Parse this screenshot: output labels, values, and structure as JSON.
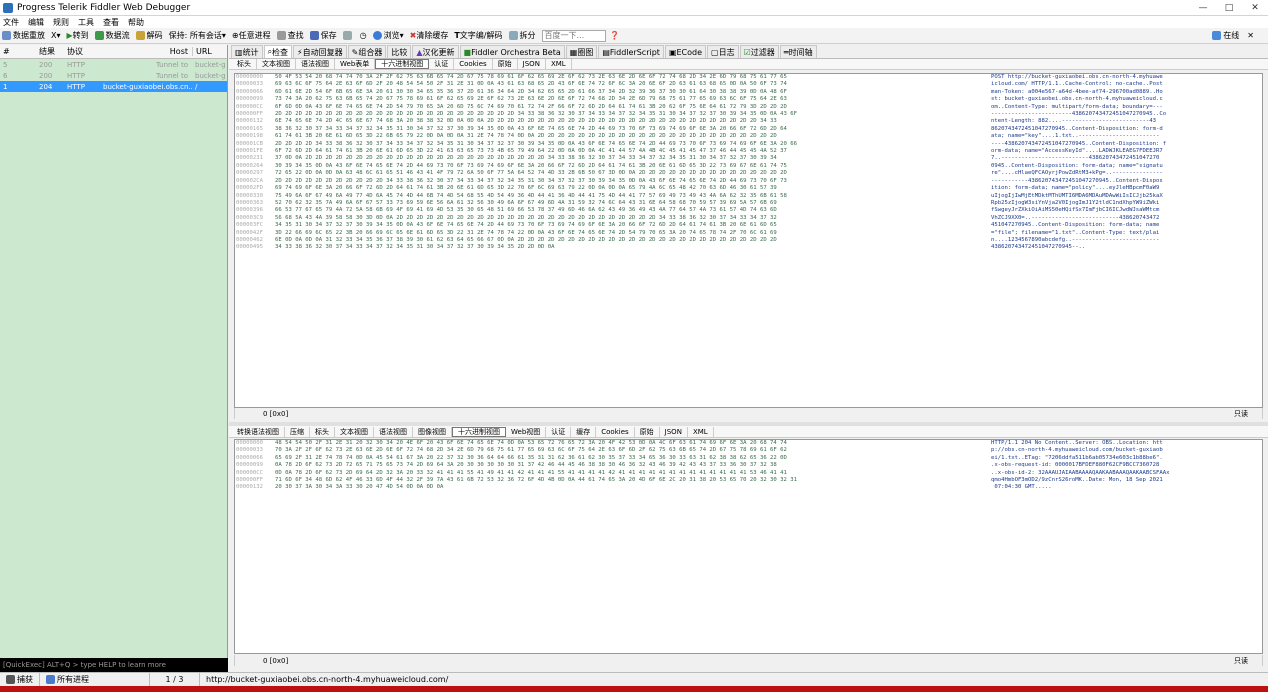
{
  "window": {
    "title": "Progress Telerik Fiddler Web Debugger"
  },
  "menu": [
    "文件",
    "编辑",
    "规则",
    "工具",
    "查看",
    "帮助"
  ],
  "toolbar": {
    "items": [
      "数据重放",
      "X",
      "转到",
      "数据流",
      "解码",
      "保持: 所有会话",
      "任意进程",
      "查找",
      "保存",
      "浏览",
      "清除缓存",
      "文字编/解码",
      "拆分"
    ],
    "search_placeholder": "百度一下...",
    "online": "在线"
  },
  "sessions": {
    "headers": [
      "#",
      "结果",
      "协议",
      "Host",
      "URL"
    ],
    "rows": [
      {
        "num": "5",
        "result": "200",
        "protocol": "HTTP",
        "host": "Tunnel to",
        "url": "bucket-g",
        "selected": false
      },
      {
        "num": "6",
        "result": "200",
        "protocol": "HTTP",
        "host": "Tunnel to",
        "url": "bucket-g",
        "selected": false
      },
      {
        "num": "1",
        "result": "204",
        "protocol": "HTTP",
        "host": "bucket-guxiaobei.obs.cn....",
        "url": "/",
        "selected": true
      }
    ],
    "quickexec": "[QuickExec] ALT+Q > type HELP to learn more"
  },
  "main_tabs": [
    "统计",
    "检查",
    "自动回复器",
    "组合器",
    "比较",
    "汉化更新",
    "Fiddler Orchestra Beta",
    "圈图",
    "FiddlerScript",
    "ECode",
    "日志",
    "过滤器",
    "时间轴"
  ],
  "main_tabs_active": 1,
  "request": {
    "tabs": [
      "标头",
      "文本视图",
      "语法视图",
      "Web表单",
      "十六进制视图",
      "认证",
      "Cookies",
      "原始",
      "JSON",
      "XML"
    ],
    "active": 4,
    "hex": [
      {
        "o": "00000000",
        "b": "50 4F 53 54 20 68 74 74 70 3A 2F 2F 62 75 63 6B 65 74 2D 67 75 78 69 61 6F 62 65 69 2E 6F 62 73 2E 63 6E 2D 6E 6F 72 74 68 2D 34 2E 6D 79 68 75 61 77 65",
        "a": "POST http://bucket-guxiaobei.obs.cn-north-4.myhuawe"
      },
      {
        "o": "00000033",
        "b": "69 63 6C 6F 75 64 2E 63 6F 6D 2F 20 48 54 54 50 2F 31 2E 31 0D 0A 43 61 63 68 65 2D 43 6F 6E 74 72 6F 6C 3A 20 6E 6F 2D 63 61 63 68 65 0D 0A 50 6F 73 74",
        "a": "icloud.com/ HTTP/1.1..Cache-Control: no-cache..Post"
      },
      {
        "o": "00000066",
        "b": "6D 61 6E 2D 54 6F 6B 65 6E 3A 20 61 30 30 34 65 35 36 37 2D 61 36 34 64 2D 34 62 65 65 2D 61 66 37 34 2D 32 39 36 37 30 30 61 64 30 38 38 39 0D 0A 48 6F",
        "a": "man-Token: a004e567-a64d-4bee-af74-296700ad0889..Ho"
      },
      {
        "o": "00000099",
        "b": "73 74 3A 20 62 75 63 6B 65 74 2D 67 75 78 69 61 6F 62 65 69 2E 6F 62 73 2E 63 6E 2D 6E 6F 72 74 68 2D 34 2E 6D 79 68 75 61 77 65 69 63 6C 6F 75 64 2E 63",
        "a": "st: bucket-guxiaobei.obs.cn-north-4.myhuaweicloud.c"
      },
      {
        "o": "000000CC",
        "b": "6F 6D 0D 0A 43 6F 6E 74 65 6E 74 2D 54 79 70 65 3A 20 6D 75 6C 74 69 70 61 72 74 2F 66 6F 72 6D 2D 64 61 74 61 3B 20 62 6F 75 6E 64 61 72 79 3D 2D 2D 2D",
        "a": "om..Content-Type: multipart/form-data; boundary=---"
      },
      {
        "o": "000000FF",
        "b": "2D 2D 2D 2D 2D 2D 2D 2D 2D 2D 2D 2D 2D 2D 2D 2D 2D 2D 2D 2D 2D 2D 2D 2D 34 33 38 36 32 30 37 34 33 34 37 32 34 35 31 30 34 37 32 37 30 39 34 35 0D 0A 43 6F",
        "a": "------------------------438620743472451047270945..Co"
      },
      {
        "o": "00000132",
        "b": "6E 74 65 6E 74 2D 4C 65 6E 67 74 68 3A 20 38 38 32 0D 0A 0D 0A 2D 2D 2D 2D 2D 2D 2D 2D 2D 2D 2D 2D 2D 2D 2D 2D 2D 2D 2D 2D 2D 2D 2D 2D 2D 2D 2D 34 33",
        "a": "ntent-Length: 882....--------------------------43"
      },
      {
        "o": "00000165",
        "b": "38 36 32 30 37 34 33 34 37 32 34 35 31 30 34 37 32 37 30 39 34 35 0D 0A 43 6F 6E 74 65 6E 74 2D 44 69 73 70 6F 73 69 74 69 6F 6E 3A 20 66 6F 72 6D 2D 64",
        "a": "8620743472451047270945..Content-Disposition: form-d"
      },
      {
        "o": "00000198",
        "b": "61 74 61 3B 20 6E 61 6D 65 3D 22 6B 65 79 22 0D 0A 0D 0A 31 2E 74 78 74 0D 0A 2D 2D 2D 2D 2D 2D 2D 2D 2D 2D 2D 2D 2D 2D 2D 2D 2D 2D 2D 2D 2D 2D 2D 2D",
        "a": "ata; name=\"key\"....1.txt..------------------------"
      },
      {
        "o": "000001CB",
        "b": "2D 2D 2D 2D 34 33 38 36 32 30 37 34 33 34 37 32 34 35 31 30 34 37 32 37 30 39 34 35 0D 0A 43 6F 6E 74 65 6E 74 2D 44 69 73 70 6F 73 69 74 69 6F 6E 3A 20 66",
        "a": "----438620743472451047270945..Content-Disposition: f"
      },
      {
        "o": "000001FE",
        "b": "6F 72 6D 2D 64 61 74 61 3B 20 6E 61 6D 65 3D 22 41 63 63 65 73 73 4B 65 79 49 64 22 0D 0A 0D 0A 4C 41 44 57 4A 4B 4C 45 41 45 47 37 46 44 45 45 4A 52 37",
        "a": "orm-data; name=\"AccessKeyId\"....LADWJKLEAEG7FDEEJR7"
      },
      {
        "o": "00000231",
        "b": "37 0D 0A 2D 2D 2D 2D 2D 2D 2D 2D 2D 2D 2D 2D 2D 2D 2D 2D 2D 2D 2D 2D 2D 2D 2D 2D 34 33 38 36 32 30 37 34 33 34 37 32 34 35 31 30 34 37 32 37 30 39 34",
        "a": "7..--------------------------438620743472451047270"
      },
      {
        "o": "00000264",
        "b": "30 39 34 35 0D 0A 43 6F 6E 74 65 6E 74 2D 44 69 73 70 6F 73 69 74 69 6F 6E 3A 20 66 6F 72 6D 2D 64 61 74 61 3B 20 6E 61 6D 65 3D 22 73 69 67 6E 61 74 75",
        "a": "0945..Content-Disposition: form-data; name=\"signatu"
      },
      {
        "o": "00000297",
        "b": "72 65 22 0D 0A 0D 0A 63 48 6C 61 65 51 46 43 41 4F 79 72 6A 50 6F 77 5A 64 52 74 4D 33 2B 6B 50 67 3D 0D 0A 2D 2D 2D 2D 2D 2D 2D 2D 2D 2D 2D 2D 2D 2D 2D",
        "a": "re\"....cHlaeQFCAOyrjPowZdRtM3+kPg=..---------------"
      },
      {
        "o": "000002CA",
        "b": "2D 2D 2D 2D 2D 2D 2D 2D 2D 2D 2D 34 33 38 36 32 30 37 34 33 34 37 32 34 35 31 30 34 37 32 37 30 39 34 35 0D 0A 43 6F 6E 74 65 6E 74 2D 44 69 73 70 6F 73",
        "a": "-----------438620743472451047270945..Content-Dispos"
      },
      {
        "o": "000002FD",
        "b": "69 74 69 6F 6E 3A 20 66 6F 72 6D 2D 64 61 74 61 3B 20 6E 61 6D 65 3D 22 70 6F 6C 69 63 79 22 0D 0A 0D 0A 65 79 4A 6C 65 48 42 70 63 6D 46 30 61 57 39",
        "a": "ition: form-data; name=\"policy\"....eyJleHBpcmF0aW9"
      },
      {
        "o": "00000330",
        "b": "75 49 6A 6F 67 49 6A 49 77 4D 6A 45 74 4D 44 6B 74 4D 54 68 55 4D 54 49 36 4D 44 41 36 4D 44 41 75 4D 44 41 77 57 69 49 73 49 43 4A 6A 62 32 35 6B 61 58",
        "a": "uIjogIjIwMjEtMDktMThUMTI6MDA6MDAuMDAwWiIsICJjb25kaX"
      },
      {
        "o": "00000363",
        "b": "52 70 62 32 35 7A 49 6A 6F 67 57 33 73 69 59 6E 56 6A 61 32 56 30 49 6A 6F 67 49 6D 4A 31 59 32 74 6C 64 43 31 6E 64 58 68 70 59 57 39 69 5A 57 6B 69",
        "a": "Rpb25zIjogW3siYnVja2V0IjogImJ1Y2tldC1ndXhpYW9iZWki"
      },
      {
        "o": "00000396",
        "b": "66 53 77 67 65 79 4A 72 5A 58 6B 69 4F 69 41 69 4D 53 35 30 65 48 51 69 66 53 78 37 49 6D 46 6A 62 43 49 36 49 43 4A 77 64 57 4A 73 61 57 4D 74 63 6D",
        "a": "fSwgeyJrZXkiOiAiMS50eHQifSx7ImFjbCI6ICJwdWJsaWMtcm"
      },
      {
        "o": "000003C9",
        "b": "56 68 5A 43 4A 39 58 58 30 3D 0D 0A 2D 2D 2D 2D 2D 2D 2D 2D 2D 2D 2D 2D 2D 2D 2D 2D 2D 2D 2D 2D 2D 2D 2D 2D 2D 2D 34 33 38 36 32 30 37 34 33 34 37 32",
        "a": "VhZCJ9XX0=..--------------------------438620743472"
      },
      {
        "o": "000003FC",
        "b": "34 35 31 30 34 37 32 37 30 39 34 35 0D 0A 43 6F 6E 74 65 6E 74 2D 44 69 73 70 6F 73 69 74 69 6F 6E 3A 20 66 6F 72 6D 2D 64 61 74 61 3B 20 6E 61 6D 65",
        "a": "451047270945..Content-Disposition: form-data; name"
      },
      {
        "o": "0000042F",
        "b": "3D 22 66 69 6C 65 22 3B 20 66 69 6C 65 6E 61 6D 65 3D 22 31 2E 74 78 74 22 0D 0A 43 6F 6E 74 65 6E 74 2D 54 79 70 65 3A 20 74 65 78 74 2F 70 6C 61 69",
        "a": "=\"file\"; filename=\"1.txt\"..Content-Type: text/plai"
      },
      {
        "o": "00000462",
        "b": "6E 0D 0A 0D 0A 31 32 33 34 35 36 37 38 39 30 61 62 63 64 65 66 67 0D 0A 2D 2D 2D 2D 2D 2D 2D 2D 2D 2D 2D 2D 2D 2D 2D 2D 2D 2D 2D 2D 2D 2D 2D 2D 2D 2D",
        "a": "n....1234567890abcdefg..--------------------------"
      },
      {
        "o": "00000495",
        "b": "34 33 38 36 32 30 37 34 33 34 37 32 34 35 31 30 34 37 32 37 30 39 34 35 2D 2D 0D 0A",
        "a": "438620743472451047270945--.."
      }
    ],
    "pos": "0 [0x0]",
    "readonly": "只读"
  },
  "response": {
    "tabs": [
      "转换语法视图",
      "压缩",
      "标头",
      "文本视图",
      "语法视图",
      "图像视图",
      "十六进制视图",
      "Web视图",
      "认证",
      "缓存",
      "Cookies",
      "原始",
      "JSON",
      "XML"
    ],
    "active": 6,
    "hex": [
      {
        "o": "00000000",
        "b": "48 54 54 50 2F 31 2E 31 20 32 30 34 20 4E 6F 20 43 6F 6E 74 65 6E 74 0D 0A 53 65 72 76 65 72 3A 20 4F 42 53 0D 0A 4C 6F 63 61 74 69 6F 6E 3A 20 68 74 74",
        "a": "HTTP/1.1 204 No Content..Server: OBS..Location: htt"
      },
      {
        "o": "00000033",
        "b": "70 3A 2F 2F 6F 62 73 2E 63 6E 2D 6E 6F 72 74 68 2D 34 2E 6D 79 68 75 61 77 65 69 63 6C 6F 75 64 2E 63 6F 6D 2F 62 75 63 6B 65 74 2D 67 75 78 69 61 6F 62",
        "a": "p://obs.cn-north-4.myhuaweicloud.com/bucket-guxiaob"
      },
      {
        "o": "00000066",
        "b": "65 69 2F 31 2E 74 78 74 0D 0A 45 54 61 67 3A 20 22 37 32 30 36 64 64 66 61 35 31 31 62 36 61 62 30 35 37 33 34 65 36 30 33 63 31 62 38 38 62 65 36 22 0D",
        "a": "ei/1.txt..ETag: \"7206ddfa511b6ab05734e603c1b88be6\"."
      },
      {
        "o": "00000099",
        "b": "0A 78 2D 6F 62 73 2D 72 65 71 75 65 73 74 2D 69 64 3A 20 30 30 30 30 30 31 37 42 46 44 45 46 38 38 30 46 36 32 43 46 39 42 43 43 37 33 36 30 37 32 38",
        "a": ".x-obs-request-id: 0000017BFDEF880F62CF9BCC7360728"
      },
      {
        "o": "000000CC",
        "b": "0D 0A 78 2D 6F 62 73 2D 69 64 2D 32 3A 20 33 32 41 41 41 55 41 49 41 41 42 41 41 41 55 41 41 41 41 42 41 41 41 41 41 41 41 41 41 41 41 41 41 53 46 41 41",
        "a": "..x-obs-id-2: 32AAAUJAIAABAAAAQAAKAABAAAQAAKAABCSFAAx"
      },
      {
        "o": "000000FF",
        "b": "71 6D 6F 34 48 6D 62 4F 46 33 6D 4F 44 32 2F 39 7A 43 61 6B 72 53 32 36 72 6F 4D 4B 0D 0A 44 61 74 65 3A 20 4D 6F 6E 2C 20 31 38 20 53 65 70 20 32 30 32 31",
        "a": "qmo4HmbOF3mOD2/9zCnrS26roMK..Date: Mon, 18 Sep 2021"
      },
      {
        "o": "00000132",
        "b": "20 30 37 3A 30 34 3A 33 30 20 47 4D 54 0D 0A 0D 0A",
        "a": " 07:04:30 GMT....."
      }
    ],
    "pos": "0 [0x0]",
    "readonly": "只读"
  },
  "statusbar": {
    "capture": "捕获",
    "process": "所有进程",
    "count": "1 / 3",
    "url": "http://bucket-guxiaobei.obs.cn-north-4.myhuaweicloud.com/"
  }
}
